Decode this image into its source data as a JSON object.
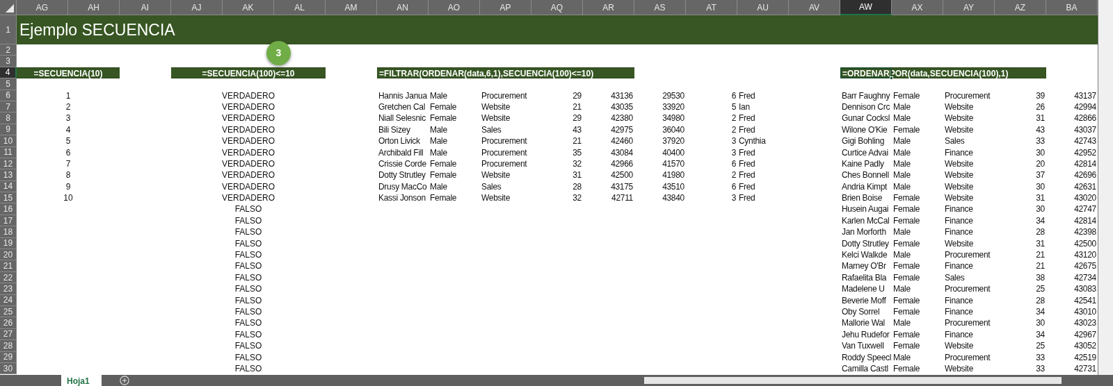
{
  "title": "Ejemplo SECUENCIA",
  "step_badge": "3",
  "column_headers": [
    {
      "label": "AG",
      "selected": false
    },
    {
      "label": "AH",
      "selected": false
    },
    {
      "label": "AI",
      "selected": false
    },
    {
      "label": "AJ",
      "selected": false
    },
    {
      "label": "AK",
      "selected": false
    },
    {
      "label": "AL",
      "selected": false
    },
    {
      "label": "AM",
      "selected": false
    },
    {
      "label": "AN",
      "selected": false
    },
    {
      "label": "AO",
      "selected": false
    },
    {
      "label": "AP",
      "selected": false
    },
    {
      "label": "AQ",
      "selected": false
    },
    {
      "label": "AR",
      "selected": false
    },
    {
      "label": "AS",
      "selected": false
    },
    {
      "label": "AT",
      "selected": false
    },
    {
      "label": "AU",
      "selected": false
    },
    {
      "label": "AV",
      "selected": false
    },
    {
      "label": "AW",
      "selected": true
    },
    {
      "label": "AX",
      "selected": false
    },
    {
      "label": "AY",
      "selected": false
    },
    {
      "label": "AZ",
      "selected": false
    },
    {
      "label": "BA",
      "selected": false
    }
  ],
  "row_headers": [
    {
      "label": "1",
      "selected": false
    },
    {
      "label": "2",
      "selected": false
    },
    {
      "label": "3",
      "selected": false
    },
    {
      "label": "4",
      "selected": true
    },
    {
      "label": "5",
      "selected": false
    },
    {
      "label": "6",
      "selected": false
    },
    {
      "label": "7",
      "selected": false
    },
    {
      "label": "8",
      "selected": false
    },
    {
      "label": "9",
      "selected": false
    },
    {
      "label": "10",
      "selected": false
    },
    {
      "label": "11",
      "selected": false
    },
    {
      "label": "12",
      "selected": false
    },
    {
      "label": "13",
      "selected": false
    },
    {
      "label": "14",
      "selected": false
    },
    {
      "label": "15",
      "selected": false
    },
    {
      "label": "16",
      "selected": false
    },
    {
      "label": "17",
      "selected": false
    },
    {
      "label": "18",
      "selected": false
    },
    {
      "label": "19",
      "selected": false
    },
    {
      "label": "20",
      "selected": false
    },
    {
      "label": "21",
      "selected": false
    },
    {
      "label": "22",
      "selected": false
    },
    {
      "label": "23",
      "selected": false
    },
    {
      "label": "24",
      "selected": false
    },
    {
      "label": "25",
      "selected": false
    },
    {
      "label": "26",
      "selected": false
    },
    {
      "label": "27",
      "selected": false
    },
    {
      "label": "28",
      "selected": false
    },
    {
      "label": "29",
      "selected": false
    },
    {
      "label": "30",
      "selected": false
    }
  ],
  "blocks": [
    {
      "kind": "list",
      "formula": "=SECUENCIA(10)",
      "values": [
        "1",
        "2",
        "3",
        "4",
        "5",
        "6",
        "7",
        "8",
        "9",
        "10"
      ]
    },
    {
      "kind": "list",
      "formula": "=SECUENCIA(100)<=10",
      "values": [
        "VERDADERO",
        "VERDADERO",
        "VERDADERO",
        "VERDADERO",
        "VERDADERO",
        "VERDADERO",
        "VERDADERO",
        "VERDADERO",
        "VERDADERO",
        "VERDADERO",
        "FALSO",
        "FALSO",
        "FALSO",
        "FALSO",
        "FALSO",
        "FALSO",
        "FALSO",
        "FALSO",
        "FALSO",
        "FALSO",
        "FALSO",
        "FALSO",
        "FALSO",
        "FALSO",
        "FALSO"
      ]
    },
    {
      "kind": "table",
      "formula": "=FILTRAR(ORDENAR(data,6,1),SECUENCIA(100)<=10)",
      "rows": [
        [
          "Hannis Janua",
          "Male",
          "Procurement",
          "29",
          "43136",
          "29530",
          "6",
          "Fred"
        ],
        [
          "Gretchen Cal",
          "Female",
          "Website",
          "21",
          "43035",
          "33920",
          "5",
          "Ian"
        ],
        [
          "Niall Selesnic",
          "Female",
          "Website",
          "29",
          "42380",
          "34980",
          "2",
          "Fred"
        ],
        [
          "Bili Sizey",
          "Male",
          "Sales",
          "43",
          "42975",
          "36040",
          "2",
          "Fred"
        ],
        [
          "Orton Livick",
          "Male",
          "Procurement",
          "21",
          "42460",
          "37920",
          "3",
          "Cynthia"
        ],
        [
          "Archibald Fill",
          "Male",
          "Procurement",
          "35",
          "43084",
          "40400",
          "3",
          "Fred"
        ],
        [
          "Crissie Corde",
          "Female",
          "Procurement",
          "32",
          "42966",
          "41570",
          "6",
          "Fred"
        ],
        [
          "Dotty Strutley",
          "Female",
          "Website",
          "31",
          "42500",
          "41980",
          "2",
          "Fred"
        ],
        [
          "Drusy MacCo",
          "Male",
          "Sales",
          "28",
          "43175",
          "43510",
          "6",
          "Fred"
        ],
        [
          "Kassi Jonson",
          "Female",
          "Website",
          "32",
          "42711",
          "43840",
          "3",
          "Fred"
        ]
      ]
    },
    {
      "kind": "table",
      "formula": "=ORDENARPOR(data,SECUENCIA(100),1)",
      "rows": [
        [
          "Barr Faughny",
          "Female",
          "Procurement",
          "39",
          "43137"
        ],
        [
          "Dennison Crc",
          "Male",
          "Website",
          "26",
          "42994"
        ],
        [
          "Gunar Cocksl",
          "Male",
          "Website",
          "31",
          "42866"
        ],
        [
          "Wilone O'Kie",
          "Female",
          "Website",
          "43",
          "43037"
        ],
        [
          "Gigi Bohling",
          "Male",
          "Sales",
          "33",
          "42743"
        ],
        [
          "Curtice Advai",
          "Male",
          "Finance",
          "30",
          "42952"
        ],
        [
          "Kaine Padly",
          "Male",
          "Website",
          "20",
          "42814"
        ],
        [
          "Ches Bonnell",
          "Male",
          "Website",
          "37",
          "42696"
        ],
        [
          "Andria Kimpt",
          "Male",
          "Website",
          "30",
          "42631"
        ],
        [
          "Brien Boise",
          "Female",
          "Website",
          "31",
          "43020"
        ],
        [
          "Husein Augai",
          "Female",
          "Finance",
          "30",
          "42747"
        ],
        [
          "Karlen McCal",
          "Female",
          "Finance",
          "34",
          "42814"
        ],
        [
          "Jan Morforth",
          "Male",
          "Finance",
          "28",
          "42398"
        ],
        [
          "Dotty Strutley",
          "Female",
          "Website",
          "31",
          "42500"
        ],
        [
          "Kelci Walkde",
          "Male",
          "Procurement",
          "21",
          "43120"
        ],
        [
          "Marney O'Br",
          "Female",
          "Finance",
          "21",
          "42675"
        ],
        [
          "Rafaelita Bla",
          "Female",
          "Sales",
          "38",
          "42734"
        ],
        [
          "Madelene U",
          "Male",
          "Procurement",
          "25",
          "43083"
        ],
        [
          "Beverie Moff",
          "Female",
          "Finance",
          "28",
          "42541"
        ],
        [
          "Oby Sorrel",
          "Female",
          "Finance",
          "34",
          "43010"
        ],
        [
          "Mallorie Wal",
          "Male",
          "Procurement",
          "30",
          "43023"
        ],
        [
          "Jehu Rudefor",
          "Female",
          "Finance",
          "34",
          "42967"
        ],
        [
          "Van Tuxwell",
          "Female",
          "Website",
          "25",
          "43052"
        ],
        [
          "Roddy Speecl",
          "Male",
          "Procurement",
          "33",
          "42519"
        ],
        [
          "Camilla Castl",
          "Female",
          "Website",
          "33",
          "42731"
        ]
      ]
    }
  ],
  "sheet_tabs": [
    {
      "label": "Hoja1",
      "selected": true
    }
  ]
}
